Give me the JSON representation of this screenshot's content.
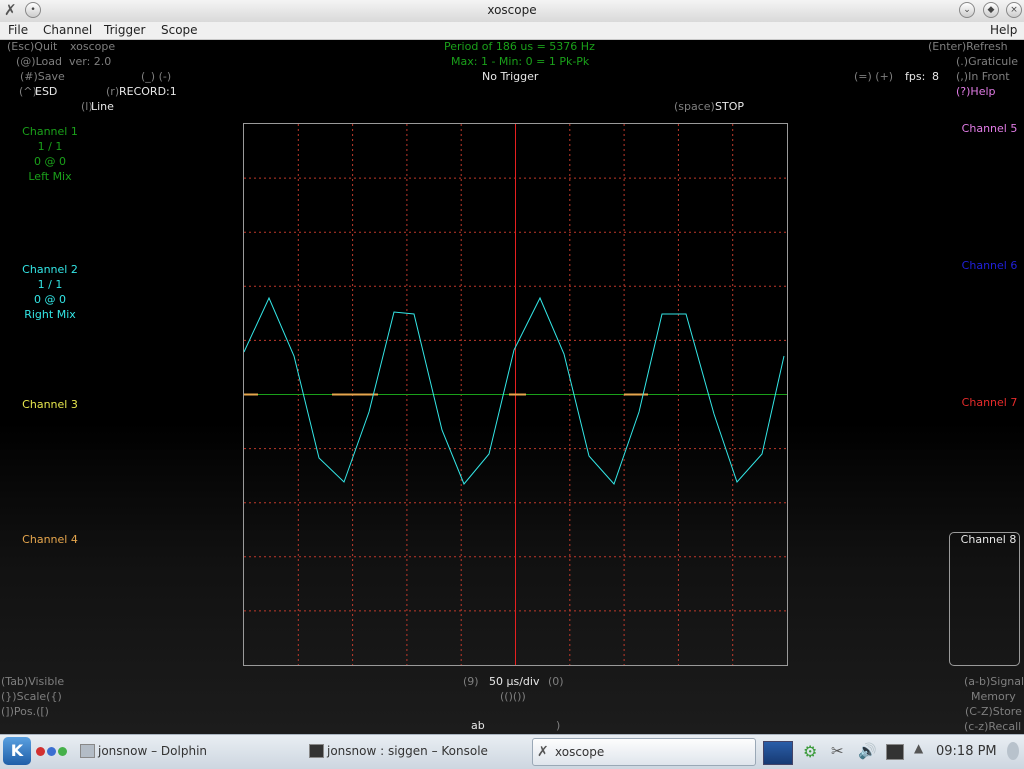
{
  "window": {
    "title": "xoscope"
  },
  "menu": {
    "items": [
      "File",
      "Channel",
      "Trigger",
      "Scope"
    ],
    "help": "Help"
  },
  "hud": {
    "quit_key": "(Esc)Quit",
    "app_name": "xoscope",
    "load_key": "(@)Load",
    "version": "ver: 2.0",
    "save_key": "(#)Save",
    "speed_keys": "(_) (-)",
    "esd_key": "(^)",
    "esd": "ESD",
    "record_key": "(r)",
    "record": "RECORD:1",
    "line_key": "(l)",
    "line": "Line",
    "period": "Period of    186 us =   5376 Hz",
    "minmax": "Max:  1 - Min:   0 =   1 Pk-Pk",
    "trigger": "No Trigger",
    "space_key": "(space)",
    "run_state": "STOP",
    "refresh": "(Enter)Refresh",
    "graticule": "(.)Graticule",
    "infront": "(,)In Front",
    "help": "(?)Help",
    "fps_keys": "(=) (+)",
    "fps_label": "fps:",
    "fps_value": "8",
    "timebase": "50 µs/div",
    "tb_left_key": "(9)",
    "tb_right_key": "(0)",
    "pos_keys": "(()())",
    "visible": "(Tab)Visible",
    "scale": "(})Scale({)",
    "pos": "(])Pos.([)",
    "signal": "(a-b)Signal",
    "memory": "Memory",
    "store": "(C-Z)Store",
    "recall": "(c-z)Recall",
    "mem_keys": "ab"
  },
  "channels": {
    "ch1": {
      "name": "Channel 1",
      "scale": "1 / 1",
      "pos": "0 @ 0",
      "source": "Left Mix",
      "color": "#1aa01a"
    },
    "ch2": {
      "name": "Channel 2",
      "scale": "1 / 1",
      "pos": "0 @ 0",
      "source": "Right Mix",
      "color": "#33e6e6"
    },
    "ch3": {
      "name": "Channel 3",
      "color": "#e6e64d"
    },
    "ch4": {
      "name": "Channel 4",
      "color": "#e6a64d"
    },
    "ch5": {
      "name": "Channel 5",
      "color": "#e27ce6"
    },
    "ch6": {
      "name": "Channel 6",
      "color": "#2020d8"
    },
    "ch7": {
      "name": "Channel 7",
      "color": "#e62b2b"
    },
    "ch8": {
      "name": "Channel 8",
      "color": "#ffffff"
    }
  },
  "taskbar": {
    "tasks": [
      {
        "label": "jonsnow – Dolphin",
        "active": false
      },
      {
        "label": "jonsnow : siggen – Konsole",
        "active": false
      },
      {
        "label": "xoscope",
        "active": true
      }
    ],
    "clock": "09:18 PM"
  },
  "colors": {
    "grid": "#c0392b",
    "trace": "#33e6e6",
    "green_trace": "#1aa01a",
    "center_line": "#e62020"
  }
}
